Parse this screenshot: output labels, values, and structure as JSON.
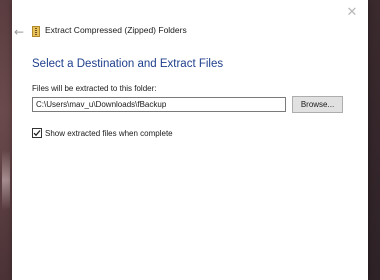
{
  "window": {
    "title": "Extract Compressed (Zipped) Folders",
    "close_glyph": "✕",
    "back_glyph": "←"
  },
  "dialog": {
    "heading": "Select a Destination and Extract Files",
    "folder_label": "Files will be extracted to this folder:",
    "path_value": "C:\\Users\\mav_u\\Downloads\\fBackup",
    "browse_label": "Browse...",
    "show_files_checked": true,
    "show_files_label": "Show extracted files when complete"
  },
  "icons": {
    "title_icon": "zip-folder-icon",
    "close_icon": "close-icon",
    "back_icon": "back-arrow-icon",
    "check_icon": "checkmark-icon"
  },
  "colors": {
    "heading": "#1f3f8c",
    "window_bg": "#ffffff",
    "button_bg": "#e1e1e1"
  }
}
